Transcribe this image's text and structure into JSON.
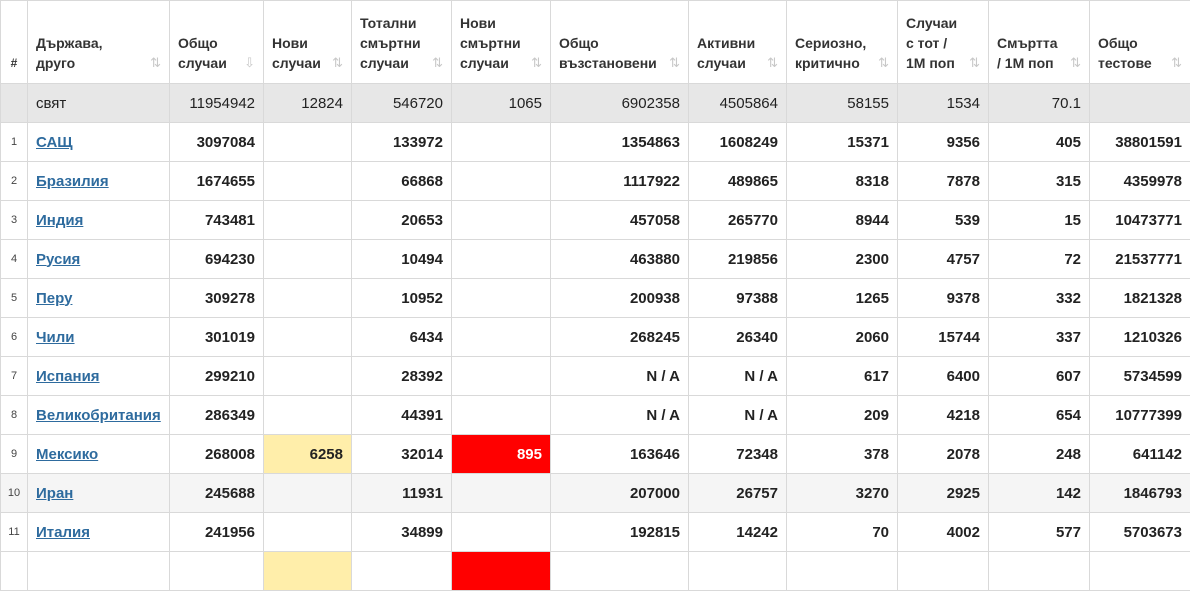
{
  "headers": [
    {
      "label": "#",
      "sortable": false
    },
    {
      "label": "Държава, друго",
      "sortable": true,
      "sort_icon": "sort-icon"
    },
    {
      "label": "Общо случаи",
      "sortable": true,
      "sort_icon": "sort-desc-icon"
    },
    {
      "label": "Нови случаи",
      "sortable": true,
      "sort_icon": "sort-icon"
    },
    {
      "label": "Тотални смъртни случаи",
      "sortable": true,
      "sort_icon": "sort-icon"
    },
    {
      "label": "Нови смъртни случаи",
      "sortable": true,
      "sort_icon": "sort-icon"
    },
    {
      "label": "Общо възстановени",
      "sortable": true,
      "sort_icon": "sort-icon"
    },
    {
      "label": "Активни случаи",
      "sortable": true,
      "sort_icon": "sort-icon"
    },
    {
      "label": "Сериозно, критично",
      "sortable": true,
      "sort_icon": "sort-icon"
    },
    {
      "label": "Случаи с тот / 1М поп",
      "sortable": true,
      "sort_icon": "sort-icon"
    },
    {
      "label": "Смъртта / 1М поп",
      "sortable": true,
      "sort_icon": "sort-icon"
    },
    {
      "label": "Общо тестове",
      "sortable": true,
      "sort_icon": "sort-icon"
    }
  ],
  "sort_glyph": "⇅",
  "sort_desc_glyph": "⇩",
  "world": {
    "rank": "",
    "country": "свят",
    "total_cases": "11954942",
    "new_cases": "12824",
    "total_deaths": "546720",
    "new_deaths": "1065",
    "total_recovered": "6902358",
    "active_cases": "4505864",
    "serious_critical": "58155",
    "cases_per_1m": "1534",
    "deaths_per_1m": "70.1",
    "total_tests": ""
  },
  "rows": [
    {
      "rank": "1",
      "country": "САЩ",
      "total_cases": "3097084",
      "new_cases": "",
      "total_deaths": "133972",
      "new_deaths": "",
      "total_recovered": "1354863",
      "active_cases": "1608249",
      "serious_critical": "15371",
      "cases_per_1m": "9356",
      "deaths_per_1m": "405",
      "total_tests": "38801591"
    },
    {
      "rank": "2",
      "country": "Бразилия",
      "total_cases": "1674655",
      "new_cases": "",
      "total_deaths": "66868",
      "new_deaths": "",
      "total_recovered": "1117922",
      "active_cases": "489865",
      "serious_critical": "8318",
      "cases_per_1m": "7878",
      "deaths_per_1m": "315",
      "total_tests": "4359978"
    },
    {
      "rank": "3",
      "country": "Индия",
      "total_cases": "743481",
      "new_cases": "",
      "total_deaths": "20653",
      "new_deaths": "",
      "total_recovered": "457058",
      "active_cases": "265770",
      "serious_critical": "8944",
      "cases_per_1m": "539",
      "deaths_per_1m": "15",
      "total_tests": "10473771"
    },
    {
      "rank": "4",
      "country": "Русия",
      "total_cases": "694230",
      "new_cases": "",
      "total_deaths": "10494",
      "new_deaths": "",
      "total_recovered": "463880",
      "active_cases": "219856",
      "serious_critical": "2300",
      "cases_per_1m": "4757",
      "deaths_per_1m": "72",
      "total_tests": "21537771"
    },
    {
      "rank": "5",
      "country": "Перу",
      "total_cases": "309278",
      "new_cases": "",
      "total_deaths": "10952",
      "new_deaths": "",
      "total_recovered": "200938",
      "active_cases": "97388",
      "serious_critical": "1265",
      "cases_per_1m": "9378",
      "deaths_per_1m": "332",
      "total_tests": "1821328"
    },
    {
      "rank": "6",
      "country": "Чили",
      "total_cases": "301019",
      "new_cases": "",
      "total_deaths": "6434",
      "new_deaths": "",
      "total_recovered": "268245",
      "active_cases": "26340",
      "serious_critical": "2060",
      "cases_per_1m": "15744",
      "deaths_per_1m": "337",
      "total_tests": "1210326"
    },
    {
      "rank": "7",
      "country": "Испания",
      "total_cases": "299210",
      "new_cases": "",
      "total_deaths": "28392",
      "new_deaths": "",
      "total_recovered": "N / A",
      "active_cases": "N / A",
      "serious_critical": "617",
      "cases_per_1m": "6400",
      "deaths_per_1m": "607",
      "total_tests": "5734599"
    },
    {
      "rank": "8",
      "country": "Великобритания",
      "total_cases": "286349",
      "new_cases": "",
      "total_deaths": "44391",
      "new_deaths": "",
      "total_recovered": "N / A",
      "active_cases": "N / A",
      "serious_critical": "209",
      "cases_per_1m": "4218",
      "deaths_per_1m": "654",
      "total_tests": "10777399"
    },
    {
      "rank": "9",
      "country": "Мексико",
      "total_cases": "268008",
      "new_cases": "6258",
      "total_deaths": "32014",
      "new_deaths": "895",
      "total_recovered": "163646",
      "active_cases": "72348",
      "serious_critical": "378",
      "cases_per_1m": "2078",
      "deaths_per_1m": "248",
      "total_tests": "641142"
    },
    {
      "rank": "10",
      "country": "Иран",
      "total_cases": "245688",
      "new_cases": "",
      "total_deaths": "11931",
      "new_deaths": "",
      "total_recovered": "207000",
      "active_cases": "26757",
      "serious_critical": "3270",
      "cases_per_1m": "2925",
      "deaths_per_1m": "142",
      "total_tests": "1846793"
    },
    {
      "rank": "11",
      "country": "Италия",
      "total_cases": "241956",
      "new_cases": "",
      "total_deaths": "34899",
      "new_deaths": "",
      "total_recovered": "192815",
      "active_cases": "14242",
      "serious_critical": "70",
      "cases_per_1m": "4002",
      "deaths_per_1m": "577",
      "total_tests": "5703673"
    }
  ],
  "colors": {
    "new_cases_highlight": "#ffeeaa",
    "new_deaths_highlight": "#ff0000",
    "link": "#2e6b9e",
    "world_row_bg": "#e7e7e7"
  }
}
